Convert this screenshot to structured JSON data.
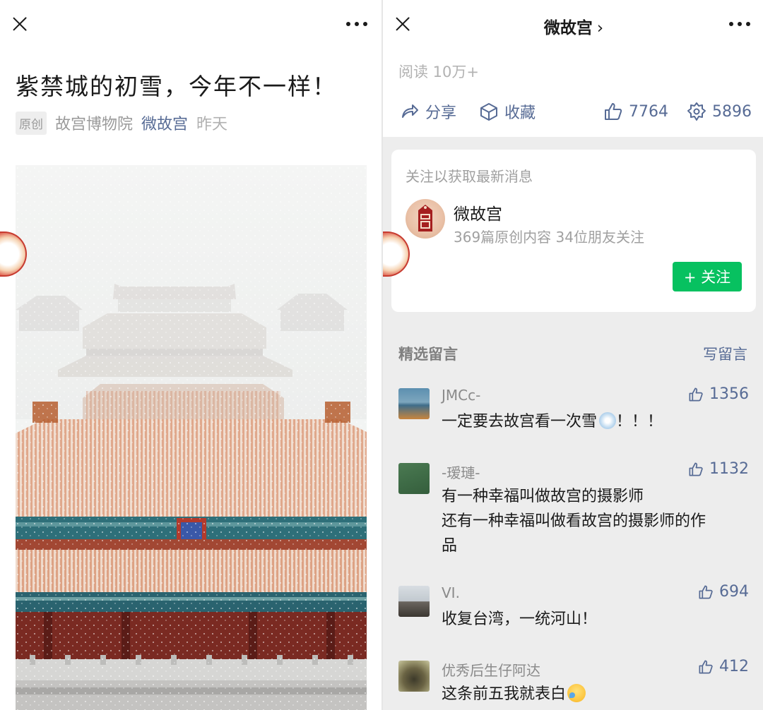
{
  "article": {
    "title": "紫禁城的初雪，今年不一样！",
    "original_tag": "原创",
    "author": "故宫博物院",
    "account": "微故宫",
    "date": "昨天"
  },
  "header_right": {
    "account_title": "微故宫",
    "arrow": "›"
  },
  "stats": {
    "read_count": "阅读 10万+",
    "share_label": "分享",
    "favorite_label": "收藏",
    "like_count": "7764",
    "wow_count": "5896"
  },
  "follow_card": {
    "hint": "关注以获取最新消息",
    "account_name": "微故宫",
    "account_sub": "369篇原创内容  34位朋友关注",
    "follow_button": "+ 关注"
  },
  "comments_section": {
    "title": "精选留言",
    "write_label": "写留言"
  },
  "comments": [
    {
      "name": "JMCc-",
      "likes": "1356",
      "lines": [
        "一定要去故宫看一次雪",
        "！！！"
      ]
    },
    {
      "name": "-瑷璉-",
      "likes": "1132",
      "lines": [
        "有一种幸福叫做故宫的摄影师",
        "还有一种幸福叫做看故宫的摄影师的作",
        "品"
      ]
    },
    {
      "name": "VI.",
      "likes": "694",
      "lines": [
        "收复台湾，一统河山！"
      ]
    },
    {
      "name": "优秀后生仔阿达",
      "likes": "412",
      "lines": [
        "这条前五我就表白"
      ]
    }
  ],
  "colors": {
    "link": "#576b95",
    "follow_green": "#07c160",
    "panel_bg": "#ededed",
    "roof_orange": "#c9683b",
    "beam_teal": "#2e6f79"
  },
  "icons": [
    "close-icon",
    "more-icon",
    "share-icon",
    "favorite-icon",
    "thumb-up-icon",
    "wow-icon",
    "snowflake-emoji",
    "crying-laugh-emoji"
  ]
}
